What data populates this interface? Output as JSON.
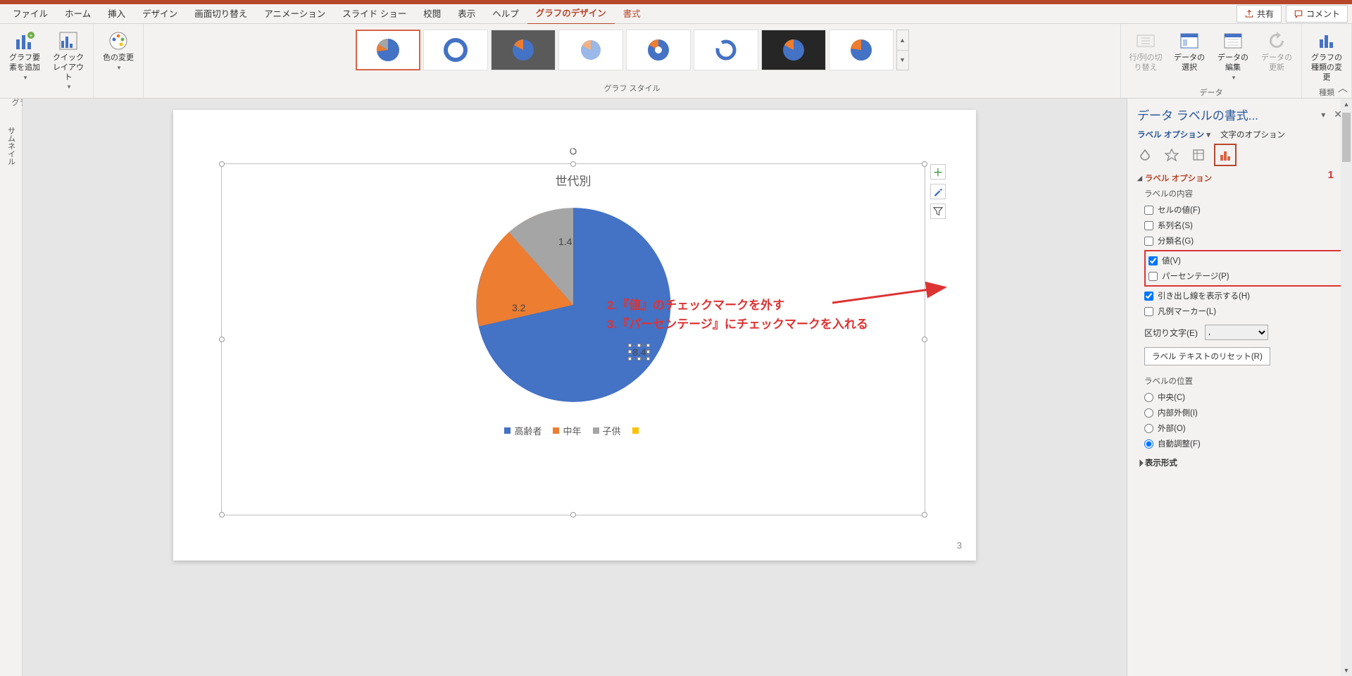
{
  "menu": {
    "tabs": [
      "ファイル",
      "ホーム",
      "挿入",
      "デザイン",
      "画面切り替え",
      "アニメーション",
      "スライド ショー",
      "校閲",
      "表示",
      "ヘルプ",
      "グラフのデザイン",
      "書式"
    ],
    "active_index": 10,
    "share": "共有",
    "comment": "コメント"
  },
  "ribbon": {
    "layout": {
      "label": "グラフのレイアウト",
      "add_element": "グラフ要素を追加",
      "quick_layout": "クイック レイアウト"
    },
    "colors": {
      "label": "色の変更"
    },
    "styles_label": "グラフ スタイル",
    "data": {
      "label": "データ",
      "switch": "行/列の切り替え",
      "select": "データの選択",
      "edit": "データの編集",
      "refresh": "データの更新"
    },
    "type": {
      "label": "種類",
      "change": "グラフの種類の変更"
    }
  },
  "thumbnail_strip": "サムネイル",
  "chart_data": {
    "type": "pie",
    "title": "世代別",
    "categories": [
      "高齢者",
      "中年",
      "子供",
      ""
    ],
    "values": [
      8.4,
      3.2,
      1.4,
      0
    ],
    "colors": [
      "#4472c4",
      "#ed7d31",
      "#a5a5a5",
      "#ffc000"
    ]
  },
  "page_number": "3",
  "chart_tools": {
    "plus": "＋",
    "brush": "brush",
    "funnel": "filter"
  },
  "annotations": {
    "line1": "2.『値』のチェックマークを外す",
    "line2": "3.『パーセンテージ』にチェックマークを入れる",
    "num1": "1"
  },
  "pane": {
    "title": "データ ラベルの書式...",
    "tab_label": "ラベル オプション",
    "tab_text": "文字のオプション",
    "section_label_options": "ラベル オプション",
    "label_content": "ラベルの内容",
    "checks": {
      "cell_value": "セルの値(F)",
      "series_name": "系列名(S)",
      "category_name": "分類名(G)",
      "value": "値(V)",
      "percentage": "パーセンテージ(P)",
      "leader_lines": "引き出し線を表示する(H)",
      "legend_marker": "凡例マーカー(L)"
    },
    "separator_label": "区切り文字(E)",
    "separator_value": ",",
    "reset": "ラベル テキストのリセット(R)",
    "position_label": "ラベルの位置",
    "positions": {
      "center": "中央(C)",
      "inside_end": "内部外側(I)",
      "outside": "外部(O)",
      "best_fit": "自動調整(F)"
    },
    "number_format": "表示形式"
  }
}
